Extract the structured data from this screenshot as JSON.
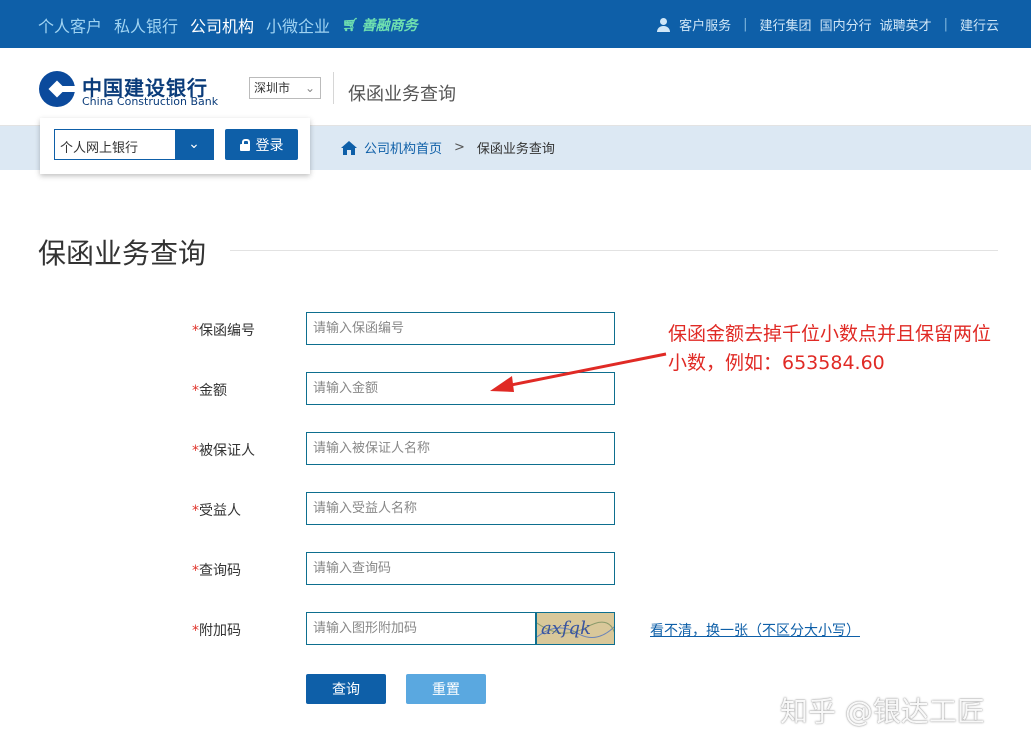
{
  "topnav": {
    "items": [
      {
        "label": "个人客户",
        "active": false
      },
      {
        "label": "私人银行",
        "active": false
      },
      {
        "label": "公司机构",
        "active": true
      },
      {
        "label": "小微企业",
        "active": false
      }
    ],
    "promo_label": "善融商务",
    "links": {
      "service": "客户服务",
      "group": "建行集团",
      "domestic": "国内分行",
      "careers": "诚聘英才",
      "cloud": "建行云"
    }
  },
  "header": {
    "brand_cn": "中国建设银行",
    "brand_en": "China Construction Bank",
    "city": "深圳市",
    "title": "保函业务查询"
  },
  "login": {
    "select_value": "个人网上银行",
    "button_label": "登录"
  },
  "breadcrumb": {
    "home": "公司机构首页",
    "separator": ">",
    "current": "保函业务查询"
  },
  "page_title": "保函业务查询",
  "form": {
    "fields": [
      {
        "star": "*",
        "label": "保函编号",
        "placeholder": "请输入保函编号"
      },
      {
        "star": "*",
        "label": "金额",
        "placeholder": "请输入金额"
      },
      {
        "star": "*",
        "label": "被保证人",
        "placeholder": "请输入被保证人名称"
      },
      {
        "star": "*",
        "label": "受益人",
        "placeholder": "请输入受益人名称"
      },
      {
        "star": "*",
        "label": "查询码",
        "placeholder": "请输入查询码"
      },
      {
        "star": "*",
        "label": "附加码",
        "placeholder": "请输入图形附加码"
      }
    ],
    "captcha_text": "axfqk",
    "refresh_link": "看不清，换一张（不区分大小写）",
    "query_button": "查询",
    "reset_button": "重置"
  },
  "annotation": {
    "text": "保函金额去掉千位小数点并且保留两位小数，例如：653584.60"
  },
  "watermark": "知乎 @银达工匠",
  "colors": {
    "primary": "#0e5fa8",
    "crumb_bg": "#dce8f3",
    "annotation": "#e02a25",
    "required_star": "#e0342a"
  }
}
